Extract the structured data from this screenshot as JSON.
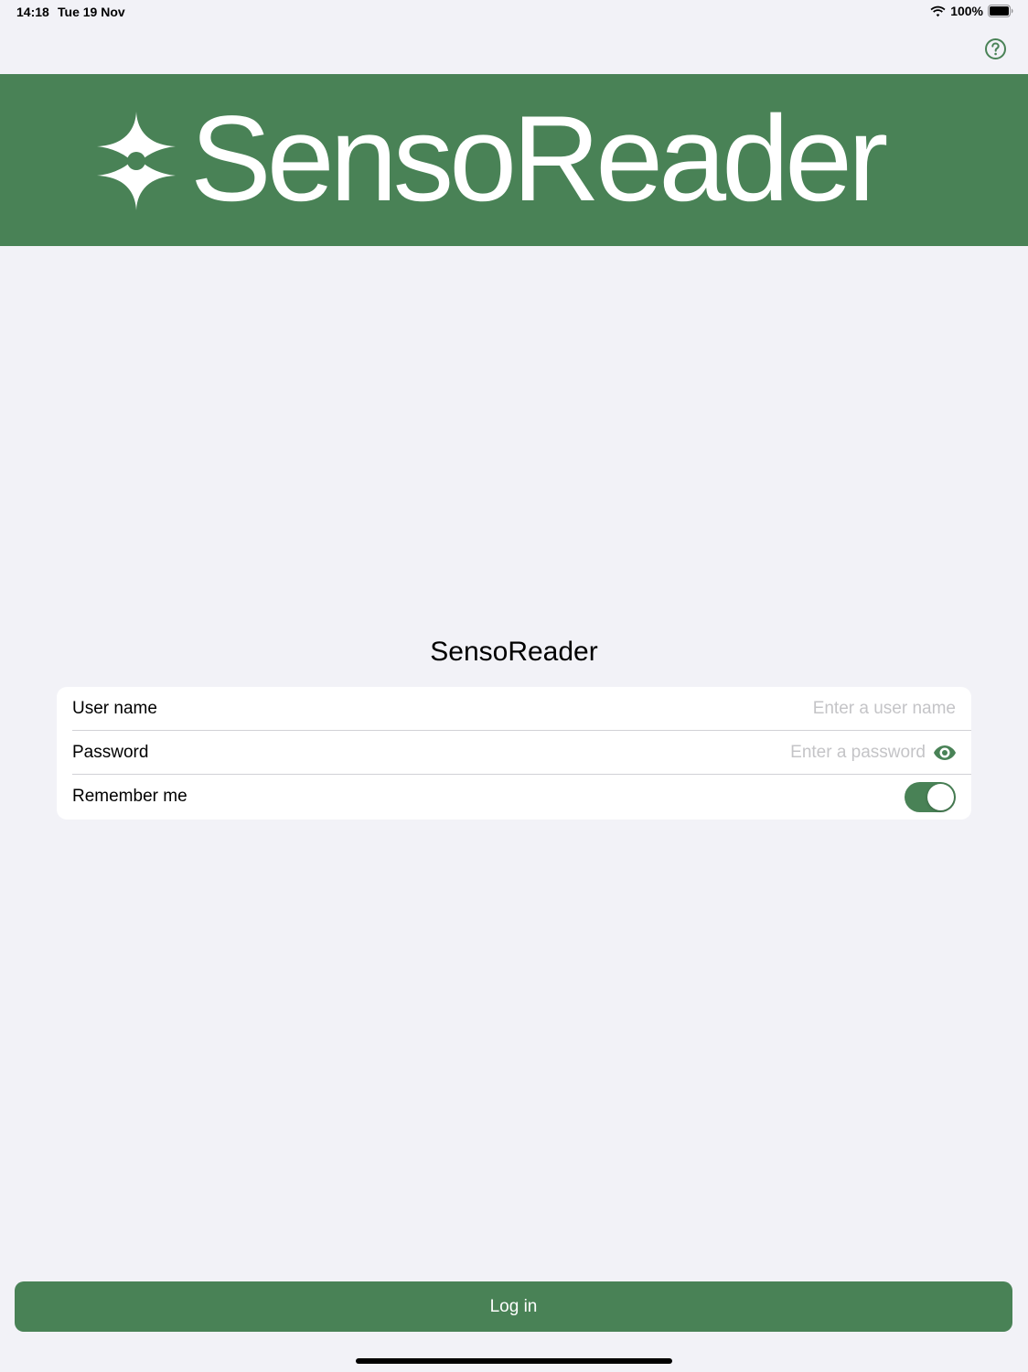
{
  "status_bar": {
    "time": "14:18",
    "date": "Tue 19 Nov",
    "battery": "100%"
  },
  "header": {
    "help_icon": "question-circle-icon"
  },
  "banner": {
    "brand_name": "SensoReader",
    "logo_icon": "senso-star-icon"
  },
  "login": {
    "title": "SensoReader",
    "username_label": "User name",
    "username_value": "",
    "username_placeholder": "Enter a user name",
    "password_label": "Password",
    "password_value": "",
    "password_placeholder": "Enter a password",
    "password_toggle_icon": "eye-icon",
    "remember_label": "Remember me",
    "remember_checked": true,
    "submit_label": "Log in"
  },
  "colors": {
    "accent": "#498256",
    "background": "#f2f2f7",
    "card": "#ffffff",
    "placeholder": "#c4c4c7"
  }
}
